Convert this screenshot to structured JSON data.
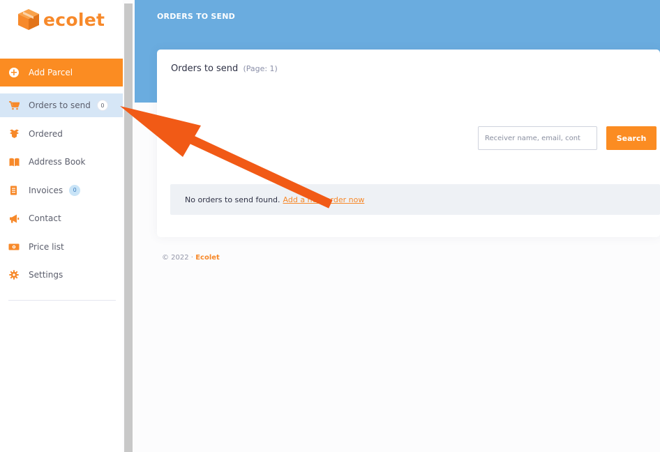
{
  "brand": {
    "name": "ecolet",
    "color": "#f7892a"
  },
  "sidebar": {
    "add_parcel": {
      "label": "Add Parcel",
      "icon": "plus-circle-icon"
    },
    "items": [
      {
        "label": "Orders to send",
        "icon": "cart-icon",
        "badge": "0",
        "active": true
      },
      {
        "label": "Ordered",
        "icon": "box-icon"
      },
      {
        "label": "Address Book",
        "icon": "book-icon"
      },
      {
        "label": "Invoices",
        "icon": "document-icon",
        "badge": "0"
      },
      {
        "label": "Contact",
        "icon": "megaphone-icon"
      },
      {
        "label": "Price list",
        "icon": "money-icon"
      },
      {
        "label": "Settings",
        "icon": "gear-icon"
      }
    ]
  },
  "header": {
    "title": "ORDERS TO SEND",
    "background": "#6aacdf"
  },
  "main": {
    "card_title": "Orders to send",
    "page_label": "(Page: 1)",
    "search": {
      "placeholder": "Receiver name, email, cont",
      "button_label": "Search"
    },
    "empty_message": "No orders to send found.",
    "empty_link": "Add a new order now"
  },
  "footer": {
    "copyright": "© 2022 ·",
    "brand": "Ecolet"
  },
  "colors": {
    "accent": "#fb8c22",
    "active_item": "#d6e6f6",
    "annotation_arrow": "#f15a16"
  }
}
